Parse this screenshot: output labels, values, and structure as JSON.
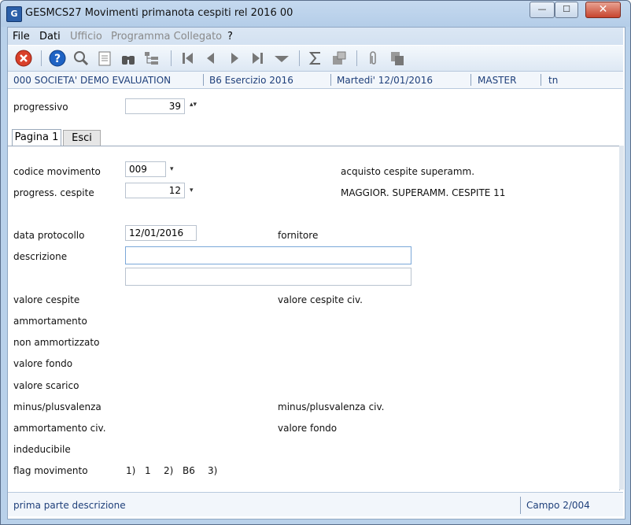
{
  "window": {
    "title": "GESMCS27  Movimenti primanota cespiti rel 2016 00",
    "icon_letter": "G",
    "minimize": "—",
    "maximize": "☐",
    "close": "✕"
  },
  "menu": [
    {
      "label": "File",
      "enabled": true
    },
    {
      "label": "Dati",
      "enabled": true
    },
    {
      "label": "Ufficio",
      "enabled": false
    },
    {
      "label": "Programma Collegato",
      "enabled": false
    },
    {
      "label": "?",
      "enabled": true
    }
  ],
  "toolbar_icons": [
    "close-red-icon",
    "help-icon",
    "search-icon",
    "document-icon",
    "binoculars-icon",
    "tree-icon",
    "first-icon",
    "prev-icon",
    "next-icon",
    "last-icon",
    "dropdown-icon",
    "sum-icon",
    "export-icon",
    "attach-icon",
    "copy-icon"
  ],
  "context": {
    "company": "000 SOCIETA'  DEMO EVALUATION",
    "exercise": "B6 Esercizio 2016",
    "date": "Martedi'  12/01/2016",
    "user": "MASTER",
    "extra": "tn"
  },
  "header": {
    "progressivo_label": "progressivo",
    "progressivo_value": "39"
  },
  "tabs": [
    {
      "label": "Pagina 1",
      "active": true
    },
    {
      "label": "Esci",
      "active": false
    }
  ],
  "form": {
    "codice_movimento_label": "codice movimento",
    "codice_movimento_value": "009",
    "codice_movimento_desc": "acquisto cespite superamm.",
    "progress_cespite_label": "progress. cespite",
    "progress_cespite_value": "12",
    "progress_cespite_desc": "MAGGIOR. SUPERAMM. CESPITE 11",
    "data_protocollo_label": "data protocollo",
    "data_protocollo_value": "12/01/2016",
    "fornitore_label": "fornitore",
    "descrizione_label": "descrizione",
    "descrizione_value": "",
    "descrizione2_value": "",
    "valore_cespite_label": "valore cespite",
    "valore_cespite_civ_label": "valore cespite civ.",
    "ammortamento_label": "ammortamento",
    "non_ammortizzato_label": "non ammortizzato",
    "valore_fondo_label": "valore fondo",
    "valore_scarico_label": "valore scarico",
    "minus_plus_label": "minus/plusvalenza",
    "minus_plus_civ_label": "minus/plusvalenza civ.",
    "ammortamento_civ_label": "ammortamento civ.",
    "valore_fondo2_label": "valore fondo",
    "indeducibile_label": "indeducibile",
    "flag_movimento_label": "flag movimento",
    "flag1_label": "1)",
    "flag1_value": "1",
    "flag2_label": "2)",
    "flag2_value": "B6",
    "flag3_label": "3)",
    "flag3_value": ""
  },
  "status": {
    "message": "prima parte descrizione",
    "campo": "Campo  2/004"
  }
}
